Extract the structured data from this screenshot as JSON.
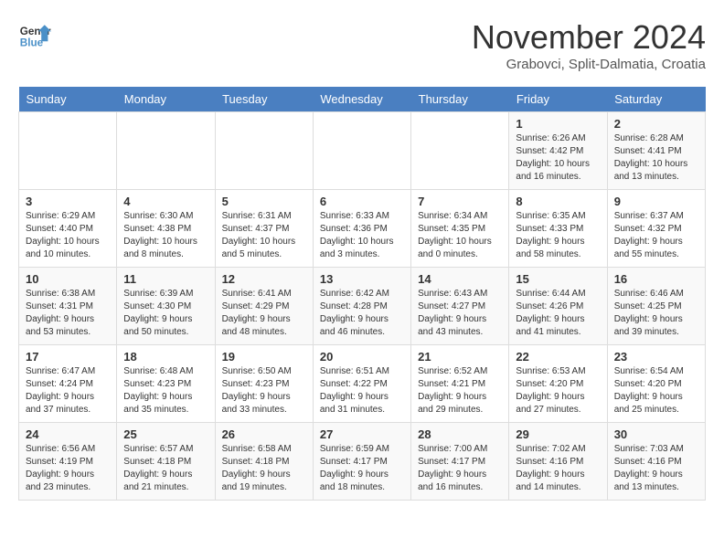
{
  "header": {
    "logo_line1": "General",
    "logo_line2": "Blue",
    "month": "November 2024",
    "location": "Grabovci, Split-Dalmatia, Croatia"
  },
  "weekdays": [
    "Sunday",
    "Monday",
    "Tuesday",
    "Wednesday",
    "Thursday",
    "Friday",
    "Saturday"
  ],
  "weeks": [
    [
      {
        "day": "",
        "info": ""
      },
      {
        "day": "",
        "info": ""
      },
      {
        "day": "",
        "info": ""
      },
      {
        "day": "",
        "info": ""
      },
      {
        "day": "",
        "info": ""
      },
      {
        "day": "1",
        "info": "Sunrise: 6:26 AM\nSunset: 4:42 PM\nDaylight: 10 hours and 16 minutes."
      },
      {
        "day": "2",
        "info": "Sunrise: 6:28 AM\nSunset: 4:41 PM\nDaylight: 10 hours and 13 minutes."
      }
    ],
    [
      {
        "day": "3",
        "info": "Sunrise: 6:29 AM\nSunset: 4:40 PM\nDaylight: 10 hours and 10 minutes."
      },
      {
        "day": "4",
        "info": "Sunrise: 6:30 AM\nSunset: 4:38 PM\nDaylight: 10 hours and 8 minutes."
      },
      {
        "day": "5",
        "info": "Sunrise: 6:31 AM\nSunset: 4:37 PM\nDaylight: 10 hours and 5 minutes."
      },
      {
        "day": "6",
        "info": "Sunrise: 6:33 AM\nSunset: 4:36 PM\nDaylight: 10 hours and 3 minutes."
      },
      {
        "day": "7",
        "info": "Sunrise: 6:34 AM\nSunset: 4:35 PM\nDaylight: 10 hours and 0 minutes."
      },
      {
        "day": "8",
        "info": "Sunrise: 6:35 AM\nSunset: 4:33 PM\nDaylight: 9 hours and 58 minutes."
      },
      {
        "day": "9",
        "info": "Sunrise: 6:37 AM\nSunset: 4:32 PM\nDaylight: 9 hours and 55 minutes."
      }
    ],
    [
      {
        "day": "10",
        "info": "Sunrise: 6:38 AM\nSunset: 4:31 PM\nDaylight: 9 hours and 53 minutes."
      },
      {
        "day": "11",
        "info": "Sunrise: 6:39 AM\nSunset: 4:30 PM\nDaylight: 9 hours and 50 minutes."
      },
      {
        "day": "12",
        "info": "Sunrise: 6:41 AM\nSunset: 4:29 PM\nDaylight: 9 hours and 48 minutes."
      },
      {
        "day": "13",
        "info": "Sunrise: 6:42 AM\nSunset: 4:28 PM\nDaylight: 9 hours and 46 minutes."
      },
      {
        "day": "14",
        "info": "Sunrise: 6:43 AM\nSunset: 4:27 PM\nDaylight: 9 hours and 43 minutes."
      },
      {
        "day": "15",
        "info": "Sunrise: 6:44 AM\nSunset: 4:26 PM\nDaylight: 9 hours and 41 minutes."
      },
      {
        "day": "16",
        "info": "Sunrise: 6:46 AM\nSunset: 4:25 PM\nDaylight: 9 hours and 39 minutes."
      }
    ],
    [
      {
        "day": "17",
        "info": "Sunrise: 6:47 AM\nSunset: 4:24 PM\nDaylight: 9 hours and 37 minutes."
      },
      {
        "day": "18",
        "info": "Sunrise: 6:48 AM\nSunset: 4:23 PM\nDaylight: 9 hours and 35 minutes."
      },
      {
        "day": "19",
        "info": "Sunrise: 6:50 AM\nSunset: 4:23 PM\nDaylight: 9 hours and 33 minutes."
      },
      {
        "day": "20",
        "info": "Sunrise: 6:51 AM\nSunset: 4:22 PM\nDaylight: 9 hours and 31 minutes."
      },
      {
        "day": "21",
        "info": "Sunrise: 6:52 AM\nSunset: 4:21 PM\nDaylight: 9 hours and 29 minutes."
      },
      {
        "day": "22",
        "info": "Sunrise: 6:53 AM\nSunset: 4:20 PM\nDaylight: 9 hours and 27 minutes."
      },
      {
        "day": "23",
        "info": "Sunrise: 6:54 AM\nSunset: 4:20 PM\nDaylight: 9 hours and 25 minutes."
      }
    ],
    [
      {
        "day": "24",
        "info": "Sunrise: 6:56 AM\nSunset: 4:19 PM\nDaylight: 9 hours and 23 minutes."
      },
      {
        "day": "25",
        "info": "Sunrise: 6:57 AM\nSunset: 4:18 PM\nDaylight: 9 hours and 21 minutes."
      },
      {
        "day": "26",
        "info": "Sunrise: 6:58 AM\nSunset: 4:18 PM\nDaylight: 9 hours and 19 minutes."
      },
      {
        "day": "27",
        "info": "Sunrise: 6:59 AM\nSunset: 4:17 PM\nDaylight: 9 hours and 18 minutes."
      },
      {
        "day": "28",
        "info": "Sunrise: 7:00 AM\nSunset: 4:17 PM\nDaylight: 9 hours and 16 minutes."
      },
      {
        "day": "29",
        "info": "Sunrise: 7:02 AM\nSunset: 4:16 PM\nDaylight: 9 hours and 14 minutes."
      },
      {
        "day": "30",
        "info": "Sunrise: 7:03 AM\nSunset: 4:16 PM\nDaylight: 9 hours and 13 minutes."
      }
    ]
  ]
}
